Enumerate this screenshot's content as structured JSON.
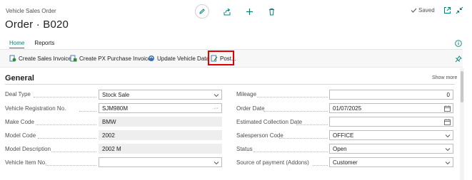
{
  "window": {
    "title": "Vehicle Sales Order"
  },
  "page": {
    "title": "Order · B020"
  },
  "status": {
    "saved": "Saved"
  },
  "tabs": [
    {
      "label": "Home",
      "active": true
    },
    {
      "label": "Reports",
      "active": false
    }
  ],
  "actions": [
    {
      "label": "Create Sales Invoice",
      "icon": "sales-invoice-icon"
    },
    {
      "label": "Create PX Purchase Invoice",
      "icon": "purchase-invoice-icon"
    },
    {
      "label": "Update Vehicle Data",
      "icon": "update-data-icon"
    },
    {
      "label": "Post...",
      "icon": "post-icon",
      "highlighted": true
    }
  ],
  "section": {
    "title": "General",
    "show_more": "Show more"
  },
  "fields_left": [
    {
      "label": "Deal Type",
      "value": "Stock Sale",
      "control": "dropdown"
    },
    {
      "label": "Vehicle Registration No.",
      "value": "SJM980M",
      "control": "lookup"
    },
    {
      "label": "Make Code",
      "value": "BMW",
      "control": "readonly"
    },
    {
      "label": "Model Code",
      "value": "2002",
      "control": "readonly"
    },
    {
      "label": "Model Description",
      "value": "2002 M",
      "control": "readonly"
    },
    {
      "label": "Vehicle Item No.",
      "value": "",
      "control": "dropdown"
    }
  ],
  "fields_right": [
    {
      "label": "Mileage",
      "value": "0",
      "control": "number"
    },
    {
      "label": "Order Date",
      "value": "01/07/2025",
      "control": "date"
    },
    {
      "label": "Estimated Collection Date",
      "value": "",
      "control": "date"
    },
    {
      "label": "Salesperson Code",
      "value": "OFFICE",
      "control": "dropdown"
    },
    {
      "label": "Status",
      "value": "Open",
      "control": "dropdown"
    },
    {
      "label": "Source of payment (Addons)",
      "value": "Customer",
      "control": "dropdown"
    }
  ],
  "colors": {
    "accent": "#00827c",
    "highlight": "#e00000"
  }
}
